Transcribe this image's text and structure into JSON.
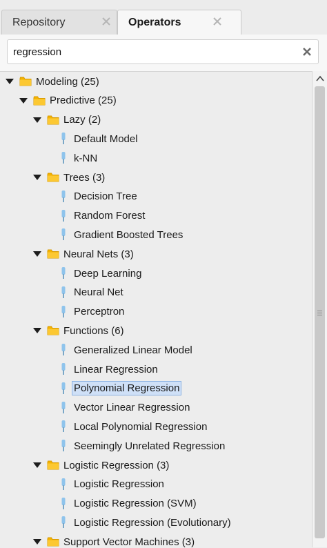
{
  "tabs": [
    {
      "label": "Repository",
      "active": false
    },
    {
      "label": "Operators",
      "active": true
    }
  ],
  "search": {
    "value": "regression",
    "placeholder": ""
  },
  "tree": {
    "modeling": "Modeling (25)",
    "predictive": "Predictive (25)",
    "groups": [
      {
        "label": "Lazy (2)",
        "items": [
          "Default Model",
          "k-NN"
        ]
      },
      {
        "label": "Trees (3)",
        "items": [
          "Decision Tree",
          "Random Forest",
          "Gradient Boosted Trees"
        ]
      },
      {
        "label": "Neural Nets (3)",
        "items": [
          "Deep Learning",
          "Neural Net",
          "Perceptron"
        ]
      },
      {
        "label": "Functions (6)",
        "items": [
          "Generalized Linear Model",
          "Linear Regression",
          "Polynomial Regression",
          "Vector Linear Regression",
          "Local Polynomial Regression",
          "Seemingly Unrelated Regression"
        ]
      },
      {
        "label": "Logistic Regression (3)",
        "items": [
          "Logistic Regression",
          "Logistic Regression (SVM)",
          "Logistic Regression (Evolutionary)"
        ]
      },
      {
        "label": "Support Vector Machines (3)",
        "items": []
      }
    ],
    "selected_item": "Polynomial Regression"
  },
  "colors": {
    "selection": "#cfe0f7",
    "folder": "#f5b301",
    "operator_icon": "#8fc4ec"
  },
  "icons": {
    "folder": "folder-icon",
    "operator": "operator-icon",
    "clear": "clear-search-icon",
    "expand": "expand-caret-icon"
  }
}
